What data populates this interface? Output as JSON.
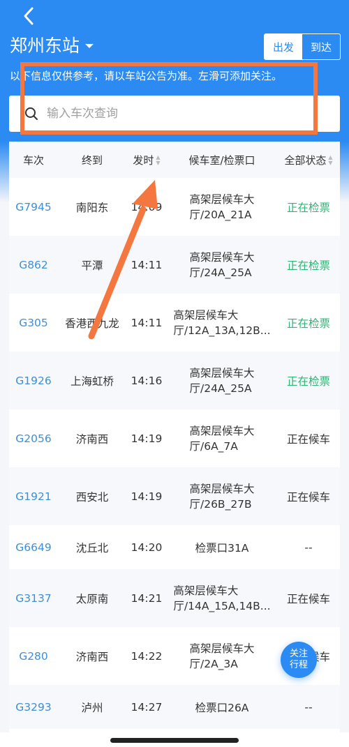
{
  "header": {
    "back_icon": "chevron-left-icon",
    "station": "郑州东站",
    "tabs": [
      {
        "label": "出发",
        "selected": true
      },
      {
        "label": "到达",
        "selected": false
      }
    ],
    "notice": "以下信息仅供参考，请以车站公告为准。左滑可添加关注。"
  },
  "search": {
    "placeholder": "输入车次查询",
    "value": "",
    "icon": "search-icon"
  },
  "table": {
    "columns": [
      "车次",
      "终到",
      "发时",
      "候车室/检票口",
      "全部状态"
    ],
    "rows": [
      {
        "train": "G7945",
        "dest": "南阳东",
        "time": "14:09",
        "hall1": "高架层候车大",
        "hall2": "厅/20A_21A",
        "status": "正在检票"
      },
      {
        "train": "G862",
        "dest": "平潭",
        "time": "14:11",
        "hall1": "高架层候车大",
        "hall2": "厅/24A_25A",
        "status": "正在检票"
      },
      {
        "train": "G305",
        "dest": "香港西九龙",
        "time": "14:11",
        "hall1": "高架层候车大",
        "hall2": "厅/12A_13A,12B...",
        "status": "正在检票"
      },
      {
        "train": "G1926",
        "dest": "上海虹桥",
        "time": "14:16",
        "hall1": "高架层候车大",
        "hall2": "厅/24A_25A",
        "status": "正在检票"
      },
      {
        "train": "G2056",
        "dest": "济南西",
        "time": "14:19",
        "hall1": "高架层候车大",
        "hall2": "厅/6A_7A",
        "status": "正在候车"
      },
      {
        "train": "G1921",
        "dest": "西安北",
        "time": "14:19",
        "hall1": "高架层候车大",
        "hall2": "厅/26B_27B",
        "status": "正在候车"
      },
      {
        "train": "G6649",
        "dest": "沈丘北",
        "time": "14:20",
        "hall1": "检票口31A",
        "hall2": "",
        "status": "--"
      },
      {
        "train": "G3137",
        "dest": "太原南",
        "time": "14:21",
        "hall1": "高架层候车大",
        "hall2": "厅/14A_15A,14B...",
        "status": "正在候车"
      },
      {
        "train": "G280",
        "dest": "济南西",
        "time": "14:22",
        "hall1": "高架层候车大",
        "hall2": "厅/2A_3A",
        "status": "正在候车"
      },
      {
        "train": "G3293",
        "dest": "泸州",
        "time": "14:27",
        "hall1": "检票口26A",
        "hall2": "",
        "status": "--"
      }
    ]
  },
  "fab": {
    "line1": "关注",
    "line2": "行程"
  },
  "colors": {
    "primary": "#2b8bf2",
    "train_no": "#3e8fd6",
    "status_checking": "#2bb673",
    "annotation": "#f47740"
  }
}
